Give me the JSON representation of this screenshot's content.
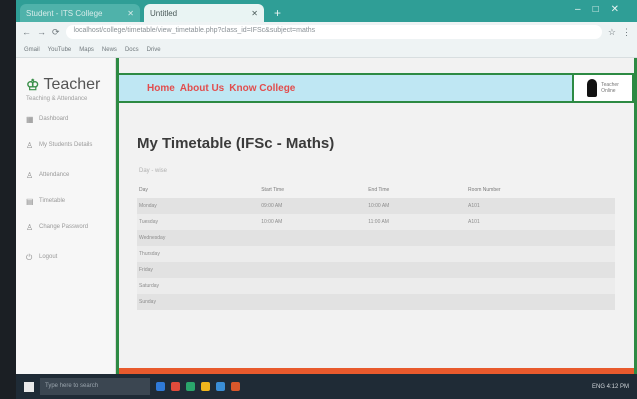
{
  "browser": {
    "tabs": [
      {
        "label": "Student - ITS College"
      },
      {
        "label": "Untitled"
      }
    ],
    "url": "localhost/college/timetable/view_timetable.php?class_id=IFSc&subject=maths",
    "bookmarks": [
      "Gmail",
      "YouTube",
      "Maps",
      "News",
      "Docs",
      "Drive"
    ]
  },
  "sidebar": {
    "brand": "Teacher",
    "brand_icon": "graduation-cap-icon",
    "brand_sub": "Teaching & Attendance",
    "items": [
      {
        "icon": "dashboard-icon",
        "label": "Dashboard"
      },
      {
        "icon": "user-icon",
        "label": "My Students Details"
      },
      {
        "icon": "user-icon",
        "label": "Attendance"
      },
      {
        "icon": "calendar-icon",
        "label": "Timetable"
      },
      {
        "icon": "user-icon",
        "label": "Change Password"
      },
      {
        "icon": "logout-icon",
        "label": "Logout"
      }
    ]
  },
  "header": {
    "nav": [
      "Home",
      "About Us",
      "Know College"
    ],
    "user": {
      "name": "Teacher",
      "role": "Online"
    }
  },
  "main": {
    "title": "My Timetable (IFSc - Maths)",
    "subtitle": "Day - wise",
    "columns": [
      "Day",
      "Start Time",
      "End Time",
      "Room Number"
    ],
    "rows": [
      [
        "Monday",
        "09:00 AM",
        "10:00 AM",
        "A101"
      ],
      [
        "Tuesday",
        "10:00 AM",
        "11:00 AM",
        "A101"
      ],
      [
        "Wednesday",
        "",
        "",
        ""
      ],
      [
        "Thursday",
        "",
        "",
        ""
      ],
      [
        "Friday",
        "",
        "",
        ""
      ],
      [
        "Saturday",
        "",
        "",
        ""
      ],
      [
        "Sunday",
        "",
        "",
        ""
      ]
    ]
  },
  "taskbar": {
    "search_placeholder": "Type here to search",
    "tray_text": "ENG  4:12 PM"
  },
  "colors": {
    "accent_green": "#2d8a43",
    "nav_red": "#e24d4d",
    "header_blue": "#bfe7f3",
    "browser_teal": "#2f9e96"
  }
}
